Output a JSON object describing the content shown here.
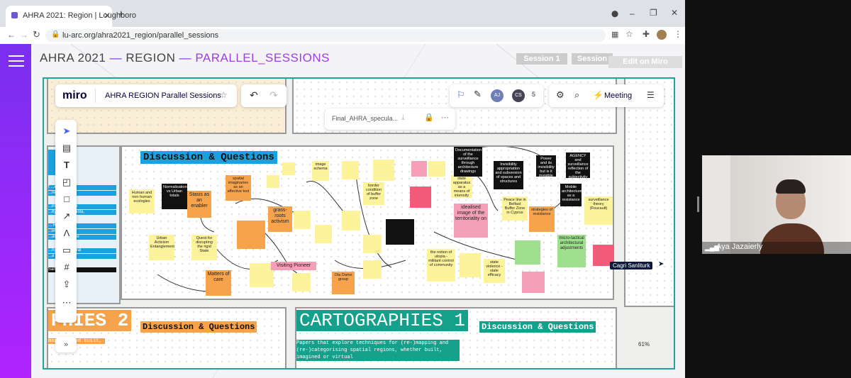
{
  "browser": {
    "tab_title": "AHRA 2021: Region | Loughboro",
    "url": "lu-arc.org/ahra2021_region/parallel_sessions"
  },
  "site": {
    "crumb_a": "AHRA 2021",
    "crumb_b": "REGION",
    "crumb_c": "PARALLEL_SESSIONS",
    "session1": "Session 1",
    "session2": "Session",
    "edit": "Edit on Miro"
  },
  "miro": {
    "logo": "miro",
    "board_title": "AHRA REGION Parallel Sessions",
    "file_name": "Final_AHRA_specula...",
    "avatar1": "AJ",
    "avatar2": "CS",
    "count": "5",
    "meeting": "Meeting",
    "zoom": "61%",
    "more": "»"
  },
  "board": {
    "heading_discussion": "Discussion & Questions",
    "heading_cartographies2": "PHIES 2",
    "heading_cartographies1": "CARTOGRAPHIES 1",
    "cart1_desc": "Papers that explore techniques for (re-)mapping and (re-)categorising spatial regions, whether built, imagined or virtual",
    "cart2_desc": "mapping and built,",
    "visiting": "Visiting Pioneer",
    "cursor_name": "Cagri Sanliturk",
    "left_texts": [
      "t ...ent impacts",
      "...resistance.",
      "...ing the Urban",
      "...ity of Famagusta,",
      "... Region: an",
      "...lect on the",
      "...ar zone village",
      "...ng of commoral",
      "...a",
      "Sanliurfa"
    ],
    "notes": {
      "human": "Human and non human ecologies",
      "normal": "Normalisation vs Urban totals",
      "stasis": "Stasis as an enabler",
      "spatial": "spatial imaginaries as an affective tool",
      "grass": "grass-roots activism",
      "quest": "Quest for disrupting the rigid State",
      "urban": "Urban Activism Entanglement",
      "matters": "Matters of care",
      "ota": "Ota Dame group",
      "image": "image schema",
      "border": "border condition of buffer zone",
      "ideal": "idealised image of the territoriality on",
      "utopia": "the notion of utopia - militant control of community",
      "state": "state apparatus as a means of intensity",
      "strategies": "strategies of resistance",
      "peace": "Peace line in Belfast Buffer Zone in Cyprus",
      "micro": "micro-tactical architectural adjustments",
      "surv": "surveillance theory (Foucault)",
      "doc": "Documentation of the surveillance through architecture drawings",
      "inv": "Invisibility appropriation and subversion of spaces and structures",
      "power": "Power and its invisibility but is it invisible ?",
      "agency": "AGENCY and surveillance reflection of the subjectivity",
      "mobile": "Mobile architecture as a resistance",
      "state2": "state violence - state efficacy"
    }
  },
  "video": {
    "name": "Aya Jazaierly"
  }
}
